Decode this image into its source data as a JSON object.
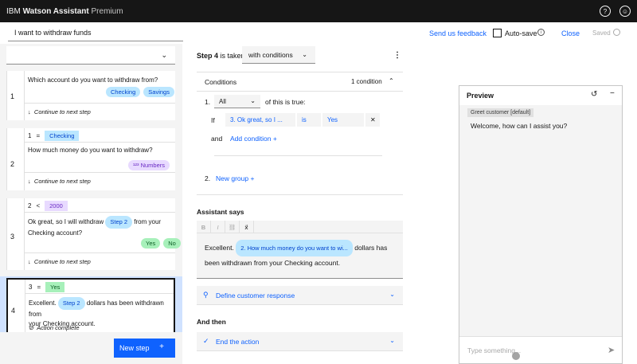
{
  "topbar": {
    "brand_ibm": "IBM",
    "brand_product": "Watson Assistant",
    "brand_tier": "Premium",
    "help_icon": "question-icon",
    "user_icon": "user-icon"
  },
  "header": {
    "action_title": "I want to withdraw funds",
    "feedback": "Send us feedback",
    "autosave": "Auto-save",
    "close": "Close",
    "saved": "Saved"
  },
  "steps": [
    {
      "number": "1",
      "question": "Which account do you want to withdraw from?",
      "options": [
        "Checking",
        "Savings"
      ],
      "continue": "Continue to next step"
    },
    {
      "number": "2",
      "cond_num": "1",
      "cond_op": "=",
      "cond_val": "Checking",
      "question": "How much money do you want to withdraw?",
      "response_type": "Numbers",
      "continue": "Continue to next step"
    },
    {
      "number": "3",
      "cond_num": "2",
      "cond_op": "<",
      "cond_val": "2000",
      "question_pre": "Ok great, so I will withdraw",
      "question_var": "Step 2",
      "question_post": "from your",
      "question_line2": "Checking account?",
      "options": [
        "Yes",
        "No"
      ],
      "continue": "Continue to next step"
    },
    {
      "number": "4",
      "cond_num": "3",
      "cond_op": "=",
      "cond_val": "Yes",
      "text_pre": "Excellent.",
      "text_var": "Step 2",
      "text_post": "dollars has been withdrawn from",
      "text_line2": "your Checking account.",
      "action_complete": "Action complete"
    }
  ],
  "new_step": "New step",
  "editor_panel": {
    "step_label": "Step 4",
    "is_taken": "is taken",
    "taken_mode": "with conditions",
    "conditions_title": "Conditions",
    "conditions_count": "1 condition",
    "group_num": "1.",
    "all_select": "All",
    "of_this": "of this is true:",
    "if": "If",
    "cond_subject": "3. Ok great, so I ...",
    "cond_operator": "is",
    "cond_value": "Yes",
    "and": "and",
    "add_condition": "Add condition",
    "group_num2": "2.",
    "new_group": "New group",
    "assistant_says": "Assistant says",
    "message_pre": "Excellent.",
    "message_var": "2. How much money do you want to wi...",
    "message_post": "dollars has",
    "message_line2": "been withdrawn from your Checking account.",
    "define_response": "Define customer response",
    "and_then": "And then",
    "end_action": "End the action"
  },
  "preview": {
    "title": "Preview",
    "greet_tag": "Greet customer [default]",
    "greeting": "Welcome, how can I assist you?",
    "placeholder": "Type something..."
  },
  "colors": {
    "accent": "#0f62fe",
    "topbar": "#161616",
    "tag_blue": "#bae6ff",
    "tag_purple": "#e8daff",
    "tag_green": "#a7f0ba"
  }
}
